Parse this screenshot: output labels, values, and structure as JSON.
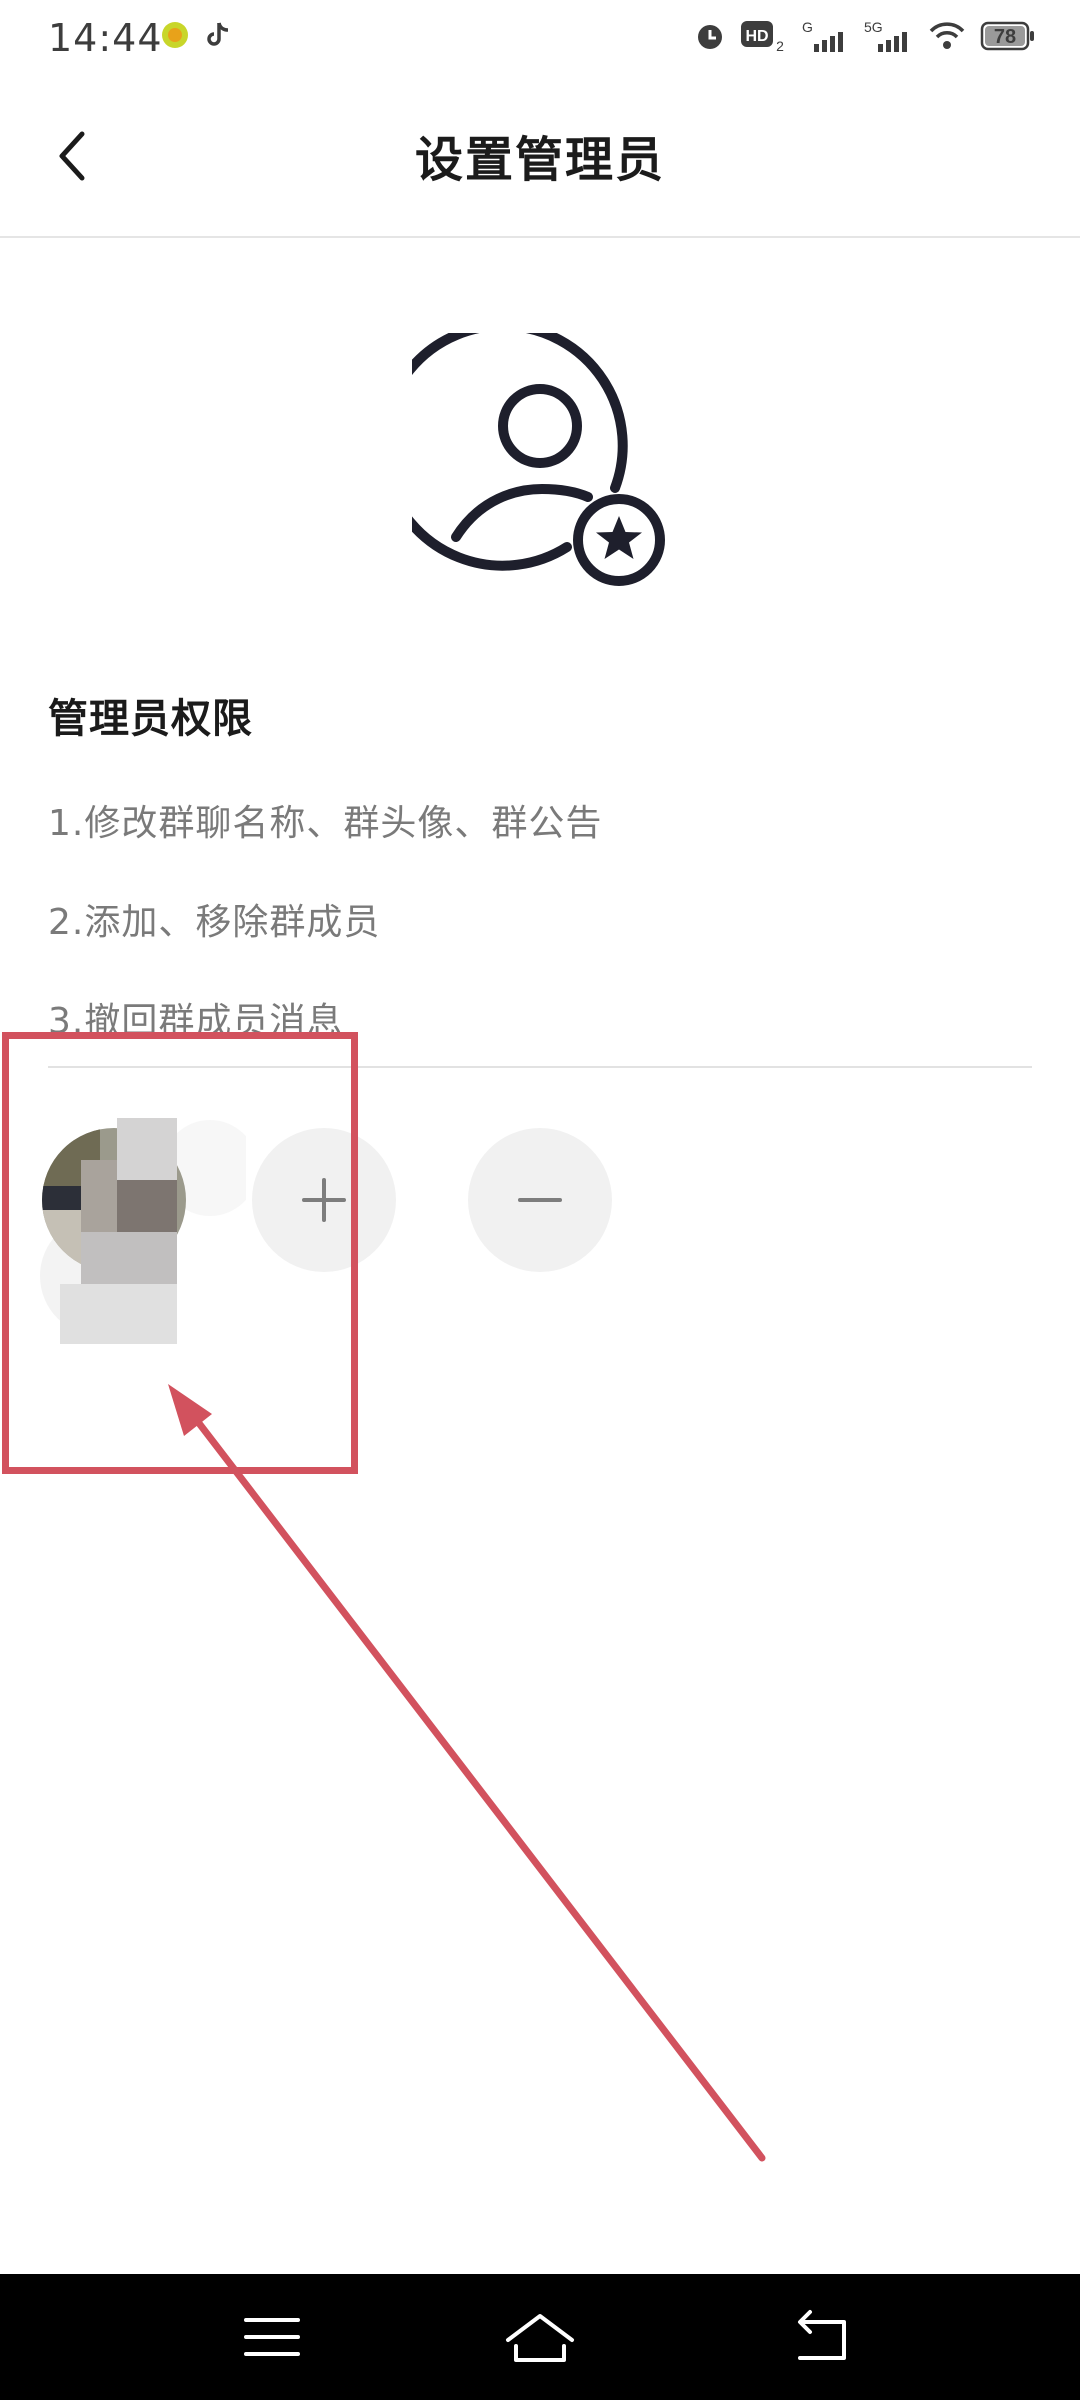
{
  "status_bar": {
    "time": "14:44",
    "battery": "78",
    "network_1": "G",
    "network_2": "5G",
    "hd_label": "HD",
    "hd_sub": "2"
  },
  "header": {
    "title": "设置管理员"
  },
  "permissions": {
    "title": "管理员权限",
    "items": [
      "1.修改群聊名称、群头像、群公告",
      "2.添加、移除群成员",
      "3.撤回群成员消息"
    ]
  },
  "colors": {
    "annotation": "#d2525e",
    "title_text": "#1b1b1b",
    "body_text": "#7a7a7a",
    "button_bg": "#f1f1f1"
  },
  "icons": {
    "back": "back-arrow-icon",
    "admin": "admin-user-star-icon",
    "add": "plus-icon",
    "remove": "minus-icon"
  }
}
